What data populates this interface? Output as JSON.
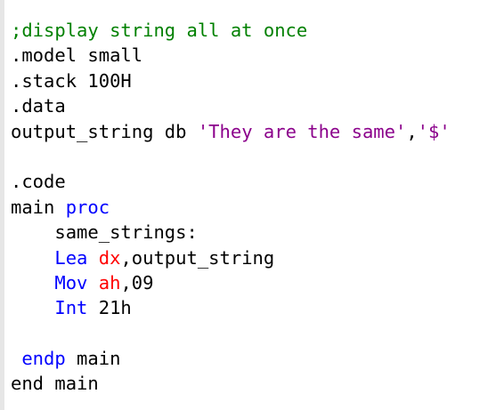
{
  "colors": {
    "comment": "#008000",
    "keyword": "#0000ff",
    "register": "#ff0000",
    "string": "#a31515",
    "string_alt": "#8b008b",
    "default": "#000000",
    "gutter": "#e6e6e6"
  },
  "code_lines": [
    [
      {
        "text": ";display string all at once",
        "type": "comment"
      }
    ],
    [
      {
        "text": ".model small",
        "type": "default"
      }
    ],
    [
      {
        "text": ".stack 100H",
        "type": "default"
      }
    ],
    [
      {
        "text": ".data",
        "type": "default"
      }
    ],
    [
      {
        "text": "output_string db ",
        "type": "default"
      },
      {
        "text": "'They are the same'",
        "type": "string2"
      },
      {
        "text": ",",
        "type": "default"
      },
      {
        "text": "'$'",
        "type": "string2"
      }
    ],
    [],
    [
      {
        "text": ".code",
        "type": "default"
      }
    ],
    [
      {
        "text": "main ",
        "type": "default"
      },
      {
        "text": "proc",
        "type": "keyword"
      }
    ],
    [
      {
        "text": "    same_strings:",
        "type": "default"
      }
    ],
    [
      {
        "text": "    ",
        "type": "default"
      },
      {
        "text": "Lea",
        "type": "keyword"
      },
      {
        "text": " ",
        "type": "default"
      },
      {
        "text": "dx",
        "type": "register"
      },
      {
        "text": ",output_string",
        "type": "default"
      }
    ],
    [
      {
        "text": "    ",
        "type": "default"
      },
      {
        "text": "Mov",
        "type": "keyword"
      },
      {
        "text": " ",
        "type": "default"
      },
      {
        "text": "ah",
        "type": "register"
      },
      {
        "text": ",09",
        "type": "default"
      }
    ],
    [
      {
        "text": "    ",
        "type": "default"
      },
      {
        "text": "Int",
        "type": "keyword"
      },
      {
        "text": " 21h",
        "type": "default"
      }
    ],
    [],
    [
      {
        "text": " ",
        "type": "default"
      },
      {
        "text": "endp",
        "type": "keyword"
      },
      {
        "text": " main",
        "type": "default"
      }
    ],
    [
      {
        "text": "end main",
        "type": "default"
      }
    ]
  ]
}
